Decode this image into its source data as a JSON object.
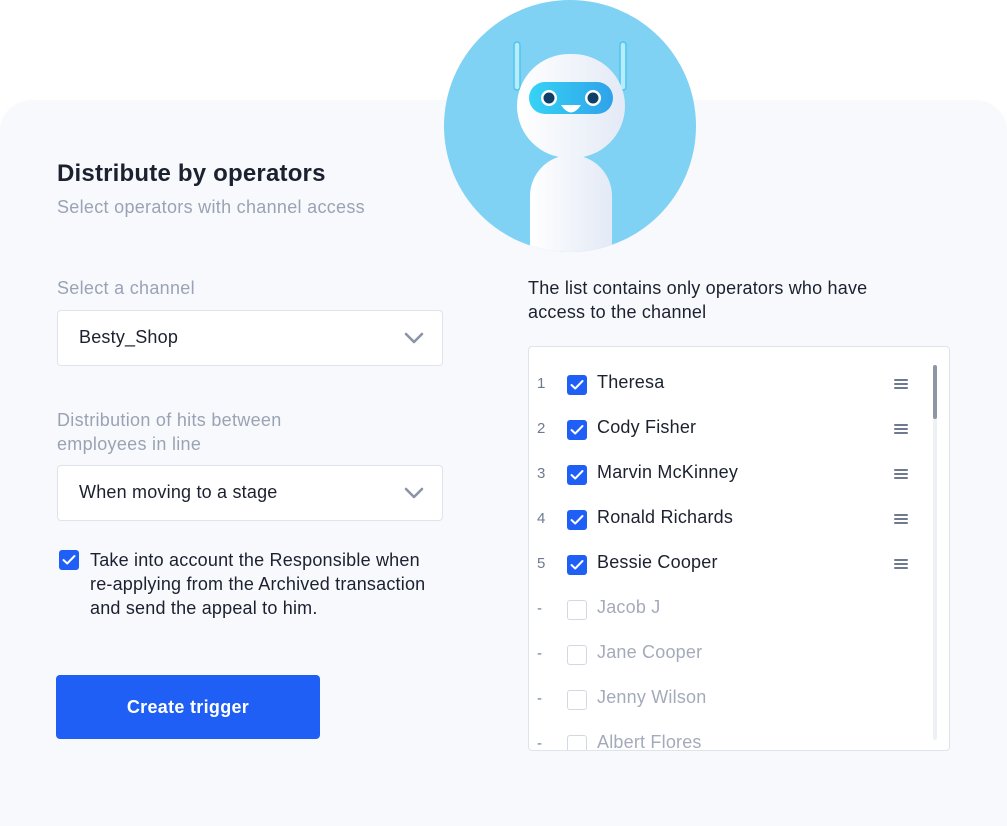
{
  "header": {
    "title": "Distribute by operators",
    "subtitle": "Select operators with channel access"
  },
  "channel": {
    "label": "Select a channel",
    "value": "Besty_Shop"
  },
  "distribution": {
    "label_line1": "Distribution of hits between",
    "label_line2": "employees in line",
    "value": "When moving to a stage"
  },
  "responsible": {
    "checked": true,
    "line1": "Take into account the Responsible when",
    "line2": "re-applying from the Archived transaction",
    "line3": "and send the appeal to him."
  },
  "create_button": "Create trigger",
  "operators_list": {
    "note_line1": "The list contains only operators who have",
    "note_line2": "access to the channel",
    "items": [
      {
        "num": "1",
        "name": "Theresa",
        "checked": true
      },
      {
        "num": "2",
        "name": "Cody Fisher",
        "checked": true
      },
      {
        "num": "3",
        "name": "Marvin McKinney",
        "checked": true
      },
      {
        "num": "4",
        "name": "Ronald Richards",
        "checked": true
      },
      {
        "num": "5",
        "name": "Bessie Cooper",
        "checked": true
      },
      {
        "num": "-",
        "name": "Jacob J",
        "checked": false
      },
      {
        "num": "-",
        "name": "Jane Cooper",
        "checked": false
      },
      {
        "num": "-",
        "name": "Jenny Wilson",
        "checked": false
      },
      {
        "num": "-",
        "name": "Albert Flores",
        "checked": false
      }
    ]
  },
  "icons": {
    "chevron": "chevron-down-icon",
    "check": "checkmark-icon",
    "drag": "drag-handle-icon",
    "mascot": "robot-mascot"
  },
  "colors": {
    "accent": "#1f5ff5",
    "mascot_bg": "#7fd2f3",
    "muted_text": "#9aa3b4",
    "card_bg": "#f8f9fd"
  }
}
